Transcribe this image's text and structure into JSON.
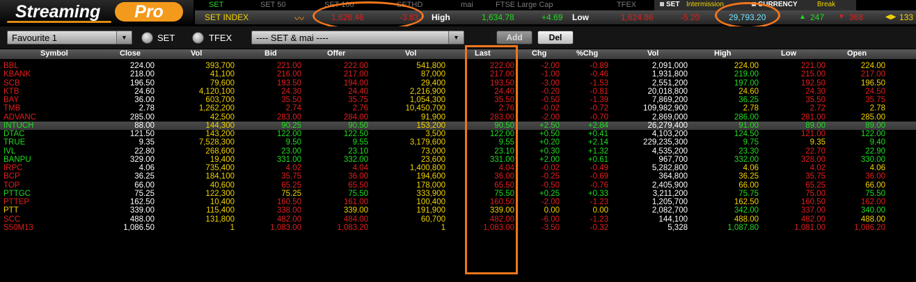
{
  "logo": {
    "part1": "Streaming",
    "part2": "Pro"
  },
  "market_tabs": [
    "SET",
    "SET 50",
    "SET 100",
    "SETHD",
    "mai",
    "FTSE Large Cap",
    "TFEX"
  ],
  "index_bar": {
    "name": "SET INDEX",
    "value": "1,626.46",
    "change": "-3.83",
    "high_label": "High",
    "high": "1,634.78",
    "high_change": "+4.69",
    "low_label": "Low",
    "low": "1,624.86",
    "low_change": "-5.20",
    "volume": "29,793.20",
    "up_count": "247",
    "down_count": "368",
    "unchanged_count": "133"
  },
  "status_bar": {
    "set_label": "SET",
    "set_status": "Intermission",
    "currency_label": "CURRENCY",
    "currency_status": "Break"
  },
  "toolbar": {
    "favourite": "Favourite 1",
    "radio_set": "SET",
    "radio_tfex": "TFEX",
    "market_select": "---- SET & mai ----",
    "add_label": "Add",
    "del_label": "Del"
  },
  "columns": [
    "Symbol",
    "Close",
    "Vol",
    "Bid",
    "Offer",
    "Vol",
    "Last",
    "Chg",
    "%Chg",
    "Vol",
    "High",
    "Low",
    "Open"
  ],
  "colors": {
    "up": "#20dd20",
    "down": "#e41e1e",
    "unchanged": "#f2d300",
    "accent": "#f0761c"
  },
  "rows": [
    {
      "symbol": "BBL",
      "close": "224.00",
      "bid_vol": "393,700",
      "bid": "221.00",
      "offer": "222.00",
      "offer_vol": "541,800",
      "last": "222.00",
      "chg": "-2.00",
      "pchg": "-0.89",
      "vol": "2,091,000",
      "high": "224.00",
      "low": "221.00",
      "open": "224.00",
      "c": [
        "red",
        "white",
        "yellow",
        "red",
        "red",
        "yellow",
        "red",
        "red",
        "red",
        "white",
        "yellow",
        "red",
        "yellow"
      ]
    },
    {
      "symbol": "KBANK",
      "close": "218.00",
      "bid_vol": "41,100",
      "bid": "216.00",
      "offer": "217.00",
      "offer_vol": "87,000",
      "last": "217.00",
      "chg": "-1.00",
      "pchg": "-0.46",
      "vol": "1,931,800",
      "high": "219.00",
      "low": "215.00",
      "open": "217.00",
      "c": [
        "red",
        "white",
        "yellow",
        "red",
        "red",
        "yellow",
        "red",
        "red",
        "red",
        "white",
        "green",
        "red",
        "red"
      ]
    },
    {
      "symbol": "SCB",
      "close": "196.50",
      "bid_vol": "79,600",
      "bid": "193.50",
      "offer": "194.00",
      "offer_vol": "29,400",
      "last": "193.50",
      "chg": "-3.00",
      "pchg": "-1.53",
      "vol": "2,551,200",
      "high": "197.00",
      "low": "192.50",
      "open": "196.50",
      "c": [
        "red",
        "white",
        "yellow",
        "red",
        "red",
        "yellow",
        "red",
        "red",
        "red",
        "white",
        "green",
        "red",
        "yellow"
      ]
    },
    {
      "symbol": "KTB",
      "close": "24.60",
      "bid_vol": "4,120,100",
      "bid": "24.30",
      "offer": "24.40",
      "offer_vol": "2,216,900",
      "last": "24.40",
      "chg": "-0.20",
      "pchg": "-0.81",
      "vol": "20,018,800",
      "high": "24.60",
      "low": "24.30",
      "open": "24.50",
      "c": [
        "red",
        "white",
        "yellow",
        "red",
        "red",
        "yellow",
        "red",
        "red",
        "red",
        "white",
        "yellow",
        "red",
        "red"
      ]
    },
    {
      "symbol": "BAY",
      "close": "36.00",
      "bid_vol": "603,700",
      "bid": "35.50",
      "offer": "35.75",
      "offer_vol": "1,054,300",
      "last": "35.50",
      "chg": "-0.50",
      "pchg": "-1.39",
      "vol": "7,869,200",
      "high": "36.25",
      "low": "35.50",
      "open": "35.75",
      "c": [
        "red",
        "white",
        "yellow",
        "red",
        "red",
        "yellow",
        "red",
        "red",
        "red",
        "white",
        "green",
        "red",
        "red"
      ]
    },
    {
      "symbol": "TMB",
      "close": "2.78",
      "bid_vol": "1,262,200",
      "bid": "2.74",
      "offer": "2.76",
      "offer_vol": "10,450,700",
      "last": "2.76",
      "chg": "-0.02",
      "pchg": "-0.72",
      "vol": "109,982,900",
      "high": "2.78",
      "low": "2.72",
      "open": "2.78",
      "c": [
        "red",
        "white",
        "yellow",
        "red",
        "red",
        "yellow",
        "red",
        "red",
        "red",
        "white",
        "yellow",
        "red",
        "yellow"
      ]
    },
    {
      "symbol": "ADVANC",
      "close": "285.00",
      "bid_vol": "42,500",
      "bid": "283.00",
      "offer": "284.00",
      "offer_vol": "91,900",
      "last": "283.00",
      "chg": "-2.00",
      "pchg": "-0.70",
      "vol": "2,869,000",
      "high": "286.00",
      "low": "281.00",
      "open": "285.00",
      "c": [
        "red",
        "white",
        "yellow",
        "red",
        "red",
        "yellow",
        "red",
        "red",
        "red",
        "white",
        "green",
        "red",
        "yellow"
      ]
    },
    {
      "symbol": "INTUCH",
      "close": "88.00",
      "bid_vol": "144,300",
      "bid": "90.25",
      "offer": "90.50",
      "offer_vol": "153,200",
      "last": "90.50",
      "chg": "+2.50",
      "pchg": "+2.84",
      "vol": "26,279,400",
      "high": "91.00",
      "low": "89.00",
      "open": "89.00",
      "c": [
        "green",
        "white",
        "yellow",
        "green",
        "green",
        "yellow",
        "green",
        "green",
        "green",
        "white",
        "green",
        "green",
        "green"
      ]
    },
    {
      "symbol": "DTAC",
      "close": "121.50",
      "bid_vol": "143,200",
      "bid": "122.00",
      "offer": "122.50",
      "offer_vol": "3,500",
      "last": "122.00",
      "chg": "+0.50",
      "pchg": "+0.41",
      "vol": "4,103,200",
      "high": "124.50",
      "low": "121.00",
      "open": "122.00",
      "c": [
        "green",
        "white",
        "yellow",
        "green",
        "green",
        "yellow",
        "green",
        "green",
        "green",
        "white",
        "green",
        "red",
        "green"
      ]
    },
    {
      "symbol": "TRUE",
      "close": "9.35",
      "bid_vol": "7,528,300",
      "bid": "9.50",
      "offer": "9.55",
      "offer_vol": "3,179,600",
      "last": "9.55",
      "chg": "+0.20",
      "pchg": "+2.14",
      "vol": "229,235,300",
      "high": "9.75",
      "low": "9.35",
      "open": "9.40",
      "c": [
        "green",
        "white",
        "yellow",
        "green",
        "green",
        "yellow",
        "green",
        "green",
        "green",
        "white",
        "green",
        "yellow",
        "green"
      ]
    },
    {
      "symbol": "IVL",
      "close": "22.80",
      "bid_vol": "268,600",
      "bid": "23.00",
      "offer": "23.10",
      "offer_vol": "73,000",
      "last": "23.10",
      "chg": "+0.30",
      "pchg": "+1.32",
      "vol": "4,535,200",
      "high": "23.30",
      "low": "22.70",
      "open": "22.90",
      "c": [
        "green",
        "white",
        "yellow",
        "green",
        "green",
        "yellow",
        "green",
        "green",
        "green",
        "white",
        "green",
        "red",
        "green"
      ]
    },
    {
      "symbol": "BANPU",
      "close": "329.00",
      "bid_vol": "19,400",
      "bid": "331.00",
      "offer": "332.00",
      "offer_vol": "23,600",
      "last": "331.00",
      "chg": "+2.00",
      "pchg": "+0.61",
      "vol": "967,700",
      "high": "332.00",
      "low": "328.00",
      "open": "330.00",
      "c": [
        "green",
        "white",
        "yellow",
        "green",
        "green",
        "yellow",
        "green",
        "green",
        "green",
        "white",
        "green",
        "red",
        "green"
      ]
    },
    {
      "symbol": "IRPC",
      "close": "4.06",
      "bid_vol": "735,400",
      "bid": "4.02",
      "offer": "4.04",
      "offer_vol": "1,400,800",
      "last": "4.04",
      "chg": "-0.02",
      "pchg": "-0.49",
      "vol": "5,282,800",
      "high": "4.06",
      "low": "4.02",
      "open": "4.06",
      "c": [
        "red",
        "white",
        "yellow",
        "red",
        "red",
        "yellow",
        "red",
        "red",
        "red",
        "white",
        "yellow",
        "red",
        "yellow"
      ]
    },
    {
      "symbol": "BCP",
      "close": "36.25",
      "bid_vol": "184,100",
      "bid": "35.75",
      "offer": "36.00",
      "offer_vol": "194,600",
      "last": "36.00",
      "chg": "-0.25",
      "pchg": "-0.69",
      "vol": "364,800",
      "high": "36.25",
      "low": "35.75",
      "open": "36.00",
      "c": [
        "red",
        "white",
        "yellow",
        "red",
        "red",
        "yellow",
        "red",
        "red",
        "red",
        "white",
        "yellow",
        "red",
        "red"
      ]
    },
    {
      "symbol": "TOP",
      "close": "66.00",
      "bid_vol": "40,600",
      "bid": "65.25",
      "offer": "65.50",
      "offer_vol": "178,000",
      "last": "65.50",
      "chg": "-0.50",
      "pchg": "-0.76",
      "vol": "2,405,900",
      "high": "66.00",
      "low": "65.25",
      "open": "66.00",
      "c": [
        "red",
        "white",
        "yellow",
        "red",
        "red",
        "yellow",
        "red",
        "red",
        "red",
        "white",
        "yellow",
        "red",
        "yellow"
      ]
    },
    {
      "symbol": "PTTGC",
      "close": "75.25",
      "bid_vol": "122,300",
      "bid": "75.25",
      "offer": "75.50",
      "offer_vol": "333,900",
      "last": "75.50",
      "chg": "+0.25",
      "pchg": "+0.33",
      "vol": "3,211,200",
      "high": "75.75",
      "low": "75.00",
      "open": "75.50",
      "c": [
        "green",
        "white",
        "yellow",
        "yellow",
        "green",
        "yellow",
        "green",
        "green",
        "green",
        "white",
        "green",
        "red",
        "green"
      ]
    },
    {
      "symbol": "PTTEP",
      "close": "162.50",
      "bid_vol": "10,400",
      "bid": "160.50",
      "offer": "161.00",
      "offer_vol": "100,400",
      "last": "160.50",
      "chg": "-2.00",
      "pchg": "-1.23",
      "vol": "1,205,700",
      "high": "162.50",
      "low": "160.50",
      "open": "162.00",
      "c": [
        "red",
        "white",
        "yellow",
        "red",
        "red",
        "yellow",
        "red",
        "red",
        "red",
        "white",
        "yellow",
        "red",
        "red"
      ]
    },
    {
      "symbol": "PTT",
      "close": "339.00",
      "bid_vol": "115,400",
      "bid": "338.00",
      "offer": "339.00",
      "offer_vol": "191,900",
      "last": "339.00",
      "chg": "0.00",
      "pchg": "0.00",
      "vol": "2,082,700",
      "high": "342.00",
      "low": "337.00",
      "open": "340.00",
      "c": [
        "yellow",
        "white",
        "yellow",
        "red",
        "yellow",
        "yellow",
        "yellow",
        "yellow",
        "yellow",
        "white",
        "green",
        "red",
        "green"
      ]
    },
    {
      "symbol": "SCC",
      "close": "488.00",
      "bid_vol": "131,800",
      "bid": "482.00",
      "offer": "484.00",
      "offer_vol": "60,700",
      "last": "482.00",
      "chg": "-6.00",
      "pchg": "-1.23",
      "vol": "144,100",
      "high": "488.00",
      "low": "482.00",
      "open": "488.00",
      "c": [
        "red",
        "white",
        "yellow",
        "red",
        "red",
        "yellow",
        "red",
        "red",
        "red",
        "white",
        "yellow",
        "red",
        "yellow"
      ]
    },
    {
      "symbol": "S50M13",
      "close": "1,086.50",
      "bid_vol": "1",
      "bid": "1,083.00",
      "offer": "1,083.20",
      "offer_vol": "1",
      "last": "1,083.00",
      "chg": "-3.50",
      "pchg": "-0.32",
      "vol": "5,328",
      "high": "1,087.80",
      "low": "1,081.00",
      "open": "1,086.20",
      "c": [
        "red",
        "white",
        "yellow",
        "red",
        "red",
        "yellow",
        "red",
        "red",
        "red",
        "white",
        "green",
        "red",
        "red"
      ]
    }
  ],
  "selected_row": 7
}
